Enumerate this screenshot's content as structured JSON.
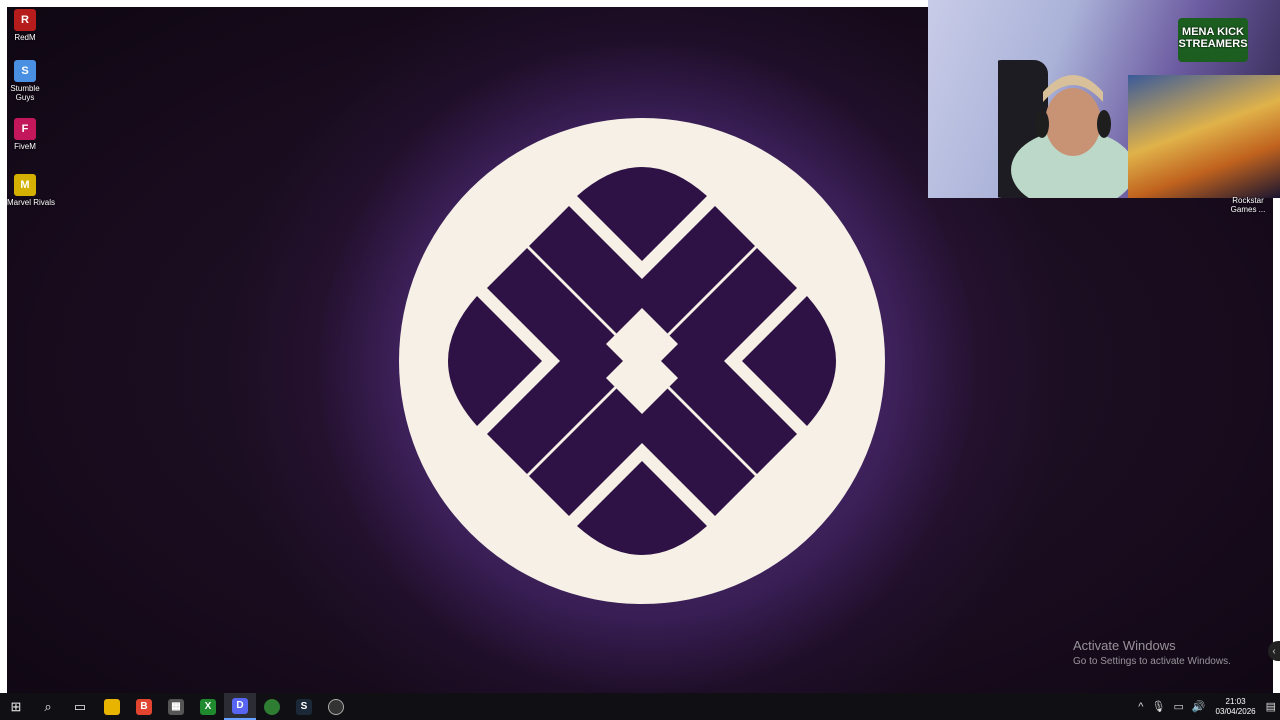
{
  "desktop_icons": [
    {
      "label": "RedM",
      "color": "#b71c1c",
      "glyph": "R"
    },
    {
      "label": "Stumble Guys",
      "color": "#4a90e2",
      "glyph": "S"
    },
    {
      "label": "FiveM",
      "color": "#c2185b",
      "glyph": "F"
    },
    {
      "label": "Marvel Rivals",
      "color": "#d4b000",
      "glyph": "M"
    }
  ],
  "webcam": {
    "logo_text": "MENA KICK STREAMERS"
  },
  "rockstar_icon": {
    "label": "Rockstar Games ..."
  },
  "watermark": {
    "title": "Activate Windows",
    "subtitle": "Go to Settings to activate Windows."
  },
  "taskbar": {
    "apps": [
      {
        "name": "start-icon",
        "glyph": "⊞"
      },
      {
        "name": "search-icon",
        "glyph": "⌕"
      },
      {
        "name": "task-view-icon",
        "glyph": "▭"
      },
      {
        "name": "file-explorer-icon",
        "glyph": "▬",
        "color": "#e8b400"
      },
      {
        "name": "brave-icon",
        "glyph": "B",
        "color": "#e2452f"
      },
      {
        "name": "store-icon",
        "glyph": "▦",
        "color": "#555"
      },
      {
        "name": "xbox-icon",
        "glyph": "X",
        "color": "#1f8a2e"
      },
      {
        "name": "discord-icon",
        "glyph": "D",
        "color": "#5865f2"
      },
      {
        "name": "chrome-icon",
        "glyph": "◉",
        "color": "#2e7d32"
      },
      {
        "name": "steam-icon",
        "glyph": "S",
        "color": "#1b2838"
      },
      {
        "name": "obs-icon",
        "glyph": "●",
        "color": "#333"
      }
    ],
    "clock": {
      "time": "21:03",
      "date": "03/04/2026"
    }
  },
  "colors": {
    "accent_purple": "#2e1245",
    "emblem_bg": "#f6f0e6"
  }
}
